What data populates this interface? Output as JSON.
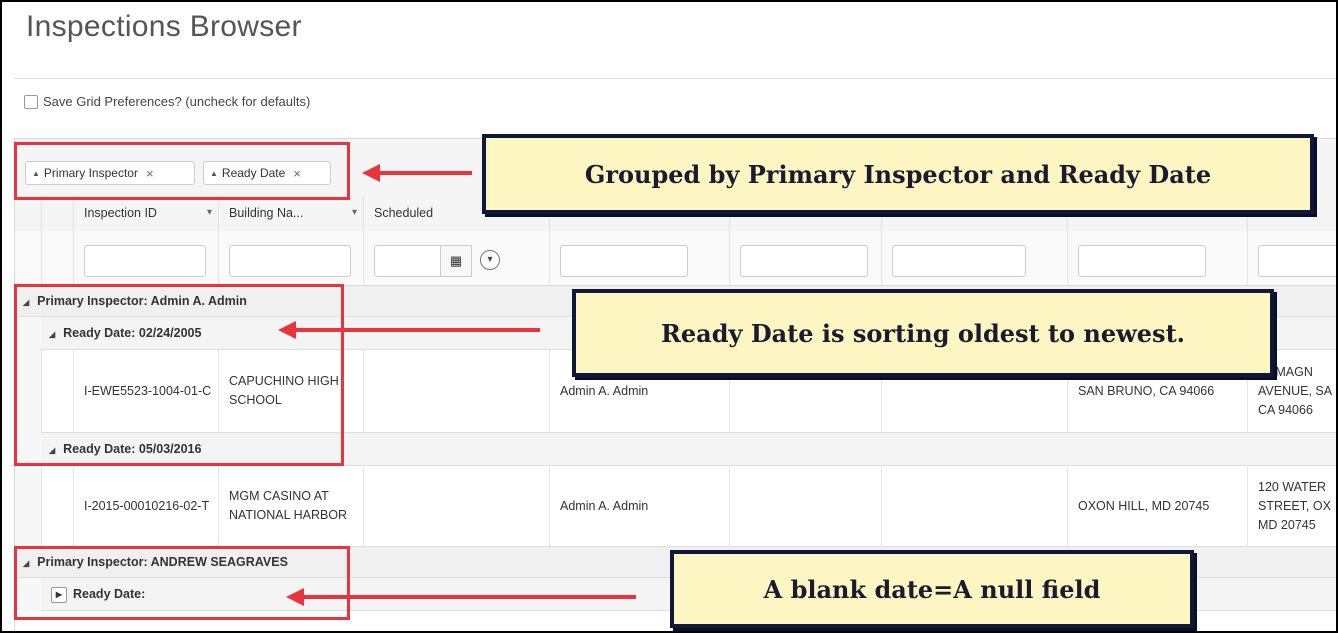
{
  "page": {
    "title": "Inspections Browser",
    "save_prefs_label": "Save Grid Preferences? (uncheck for defaults)"
  },
  "group_chips": [
    {
      "label": "Primary Inspector",
      "close": "×"
    },
    {
      "label": "Ready Date",
      "close": "×"
    }
  ],
  "columns": {
    "inspection_id": "Inspection ID",
    "building_name": "Building Na...",
    "scheduled": "Scheduled"
  },
  "groups": {
    "inspector1": "Primary Inspector: Admin A. Admin",
    "date1": "Ready Date: 02/24/2005",
    "date2": "Ready Date: 05/03/2016",
    "inspector2": "Primary Inspector: ANDREW SEAGRAVES",
    "date3": "Ready Date:"
  },
  "rows": [
    {
      "inspection_id": "I-EWE5523-1004-01-C",
      "building": "CAPUCHINO HIGH SCHOOL",
      "primary_inspector": "Admin A. Admin",
      "city": "SAN BRUNO, CA 94066",
      "address": "01 MAGN AVENUE, SA CA 94066"
    },
    {
      "inspection_id": "I-2015-00010216-02-T",
      "building": "MGM CASINO AT NATIONAL HARBOR",
      "primary_inspector": "Admin A. Admin",
      "city": "OXON HILL, MD 20745",
      "address": "120 WATER STREET, OX MD 20745"
    }
  ],
  "callouts": {
    "grouped": "Grouped by Primary Inspector and Ready Date",
    "sorting": "Ready Date is sorting oldest to newest.",
    "blank": "A blank date=A null field"
  },
  "colors": {
    "annotation_red": "#e8343c",
    "callout_bg": "#fdf6c2",
    "callout_border": "#10183a"
  }
}
